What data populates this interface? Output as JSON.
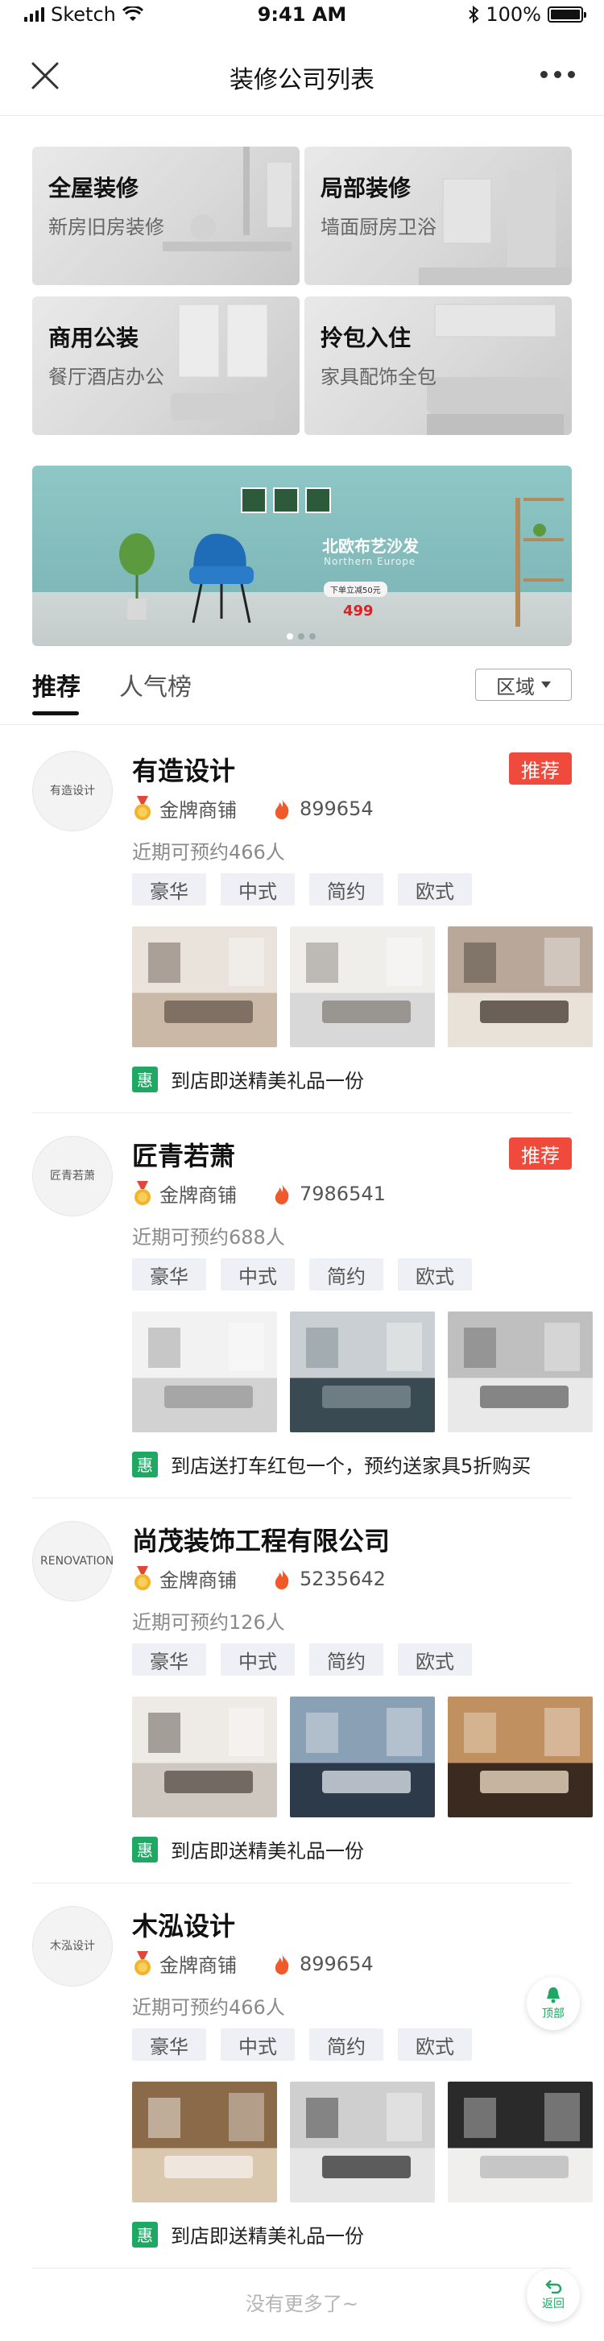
{
  "status_bar": {
    "carrier": "Sketch",
    "time": "9:41 AM",
    "battery": "100%"
  },
  "nav": {
    "title": "装修公司列表"
  },
  "categories": [
    {
      "title": "全屋装修",
      "subtitle": "新房旧房装修"
    },
    {
      "title": "局部装修",
      "subtitle": "墙面厨房卫浴"
    },
    {
      "title": "商用公装",
      "subtitle": "餐厅酒店办公"
    },
    {
      "title": "拎包入住",
      "subtitle": "家具配饰全包"
    }
  ],
  "banner": {
    "headline": "北欧布艺沙发",
    "subline": "Northern Europe",
    "coupon": "下单立减50元",
    "price": "499"
  },
  "tabs": {
    "active": "推荐",
    "other": "人气榜",
    "region": "区域"
  },
  "companies": [
    {
      "name": "有造设计",
      "logo_text": "有造设计",
      "badge": "推荐",
      "rank": "金牌商铺",
      "heat": "899654",
      "booking": "近期可预约466人",
      "tags": [
        "豪华",
        "中式",
        "简约",
        "欧式"
      ],
      "promo_icon": "惠",
      "promo": "到店即送精美礼品一份"
    },
    {
      "name": "匠青若萧",
      "logo_text": "匠青若萧",
      "badge": "推荐",
      "rank": "金牌商铺",
      "heat": "7986541",
      "booking": "近期可预约688人",
      "tags": [
        "豪华",
        "中式",
        "简约",
        "欧式"
      ],
      "promo_icon": "惠",
      "promo": "到店送打车红包一个，预约送家具5折购买"
    },
    {
      "name": "尚茂装饰工程有限公司",
      "logo_text": "RENOVATION",
      "badge": "",
      "rank": "金牌商铺",
      "heat": "5235642",
      "booking": "近期可预约126人",
      "tags": [
        "豪华",
        "中式",
        "简约",
        "欧式"
      ],
      "promo_icon": "惠",
      "promo": "到店即送精美礼品一份"
    },
    {
      "name": "木泓设计",
      "logo_text": "木泓设计",
      "badge": "",
      "rank": "金牌商铺",
      "heat": "899654",
      "booking": "近期可预约466人",
      "tags": [
        "豪华",
        "中式",
        "简约",
        "欧式"
      ],
      "promo_icon": "惠",
      "promo": "到店即送精美礼品一份"
    }
  ],
  "footer": {
    "end_text": "没有更多了~",
    "top_label": "顶部",
    "back_label": "返回"
  },
  "colors": {
    "accent_green": "#1fa764",
    "badge_red": "#f04a3c",
    "fire": "#f05a2a"
  }
}
